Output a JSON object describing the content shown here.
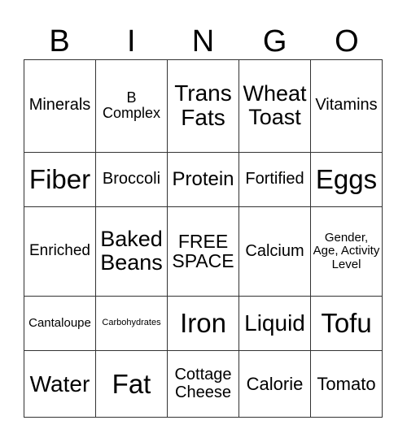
{
  "header": [
    "B",
    "I",
    "N",
    "G",
    "O"
  ],
  "rows": [
    [
      {
        "text": "Minerals",
        "size": 20
      },
      {
        "text": "B Complex",
        "size": 18
      },
      {
        "text": "Trans Fats",
        "size": 28
      },
      {
        "text": "Wheat Toast",
        "size": 27
      },
      {
        "text": "Vitamins",
        "size": 20
      }
    ],
    [
      {
        "text": "Fiber",
        "size": 33
      },
      {
        "text": "Broccoli",
        "size": 20
      },
      {
        "text": "Protein",
        "size": 24
      },
      {
        "text": "Fortified",
        "size": 20
      },
      {
        "text": "Eggs",
        "size": 33
      }
    ],
    [
      {
        "text": "Enriched",
        "size": 19
      },
      {
        "text": "Baked Beans",
        "size": 27
      },
      {
        "text": "FREE SPACE",
        "size": 23
      },
      {
        "text": "Calcium",
        "size": 20
      },
      {
        "text": "Gender, Age, Activity Level",
        "size": 15
      }
    ],
    [
      {
        "text": "Cantaloupe",
        "size": 15
      },
      {
        "text": "Carbohydrates",
        "size": 11
      },
      {
        "text": "Iron",
        "size": 33
      },
      {
        "text": "Liquid",
        "size": 28
      },
      {
        "text": "Tofu",
        "size": 33
      }
    ],
    [
      {
        "text": "Water",
        "size": 28
      },
      {
        "text": "Fat",
        "size": 33
      },
      {
        "text": "Cottage Cheese",
        "size": 20
      },
      {
        "text": "Calorie",
        "size": 22
      },
      {
        "text": "Tomato",
        "size": 22
      }
    ]
  ]
}
